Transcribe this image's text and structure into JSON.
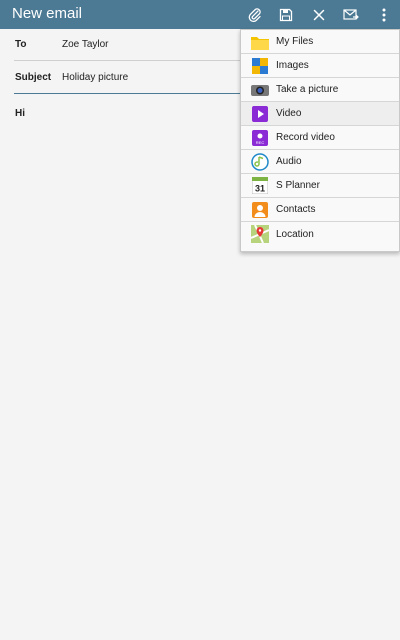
{
  "header": {
    "title": "New email",
    "actions": [
      {
        "name": "attach",
        "icon": "paperclip-icon"
      },
      {
        "name": "save",
        "icon": "save-icon"
      },
      {
        "name": "discard",
        "icon": "close-icon"
      },
      {
        "name": "send",
        "icon": "send-mail-icon"
      },
      {
        "name": "more",
        "icon": "more-vertical-icon"
      }
    ],
    "bar_color": "#4c7a95"
  },
  "compose": {
    "to_label": "To",
    "to_value": "Zoe Taylor",
    "subject_label": "Subject",
    "subject_value": "Holiday picture",
    "body": "Hi"
  },
  "attach_menu": {
    "items": [
      {
        "label": "My Files",
        "icon": "folder-icon"
      },
      {
        "label": "Images",
        "icon": "images-icon"
      },
      {
        "label": "Take a picture",
        "icon": "camera-icon"
      },
      {
        "label": "Video",
        "icon": "video-icon"
      },
      {
        "label": "Record video",
        "icon": "record-video-icon",
        "icon_text": "REC"
      },
      {
        "label": "Audio",
        "icon": "audio-icon"
      },
      {
        "label": "S Planner",
        "icon": "calendar-icon",
        "icon_text": "31"
      },
      {
        "label": "Contacts",
        "icon": "contacts-icon"
      },
      {
        "label": "Location",
        "icon": "map-icon"
      }
    ]
  }
}
